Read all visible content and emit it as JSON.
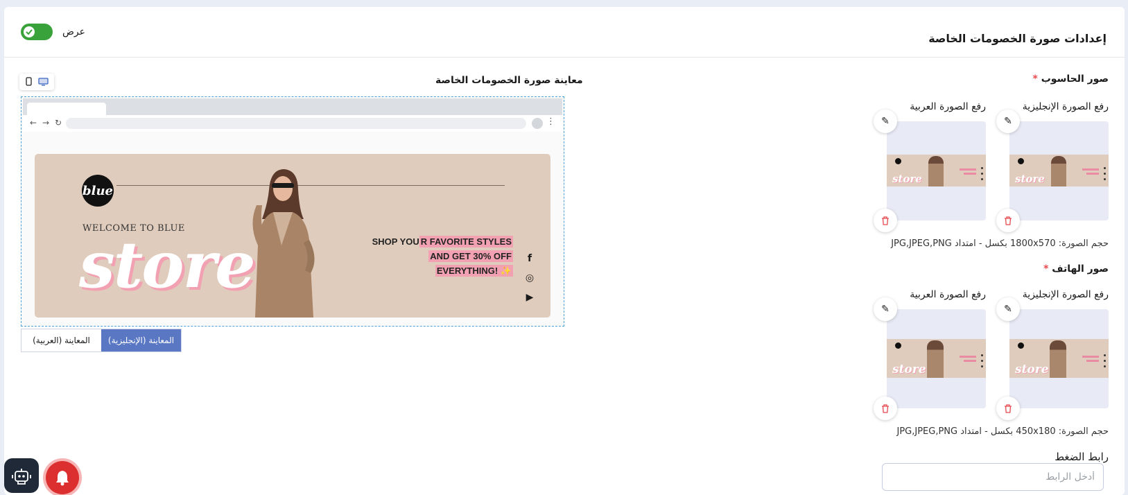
{
  "header": {
    "title": "إعدادات صورة الخصومات الخاصة",
    "toggle_label": "عرض",
    "toggle_on": true
  },
  "desktop": {
    "title": "صور الحاسوب",
    "required_mark": "*",
    "english_label": "رفع الصورة الإنجليزية",
    "arabic_label": "رفع الصورة العربية",
    "size_note": "حجم الصورة: 1800x570 بكسل - امتداد JPG,JPEG,PNG"
  },
  "mobile": {
    "title": "صور الهاتف",
    "required_mark": "*",
    "english_label": "رفع الصورة الإنجليزية",
    "arabic_label": "رفع الصورة العربية",
    "size_note": "حجم الصورة: 450x180 بكسل - امتداد JPG,JPEG,PNG"
  },
  "link": {
    "label": "رابط الضغط",
    "placeholder": "أدخل الرابط",
    "value": ""
  },
  "preview": {
    "title": "معاينة صورة الخصومات الخاصة",
    "tab_english": "المعاينة (الإنجليزية)",
    "tab_arabic": "المعاينة (العربية)",
    "active_tab": "english"
  },
  "banner": {
    "logo": "blue",
    "welcome": "WELCOME TO BLUE",
    "store": "store",
    "promo_line1_plain": "SHOP YOU",
    "promo_line1_hl": "R FAVORITE STYLES",
    "promo_line2": "AND GET 30% OFF",
    "promo_line3": "EVERYTHING! ✨",
    "social": [
      "f",
      "◎",
      "▶"
    ]
  },
  "colors": {
    "accent": "#5a77c4",
    "toggle_on": "#3aa23a",
    "required": "#e5484d",
    "danger": "#dc2f2f",
    "banner_bg": "#e0ccbd",
    "banner_pink": "#f2a1b2"
  },
  "icons": {
    "edit": "pencil-icon",
    "delete": "trash-icon",
    "mobile": "mobile-icon",
    "desktop": "desktop-icon",
    "assistant": "robot-icon",
    "notifications": "bell-icon"
  }
}
